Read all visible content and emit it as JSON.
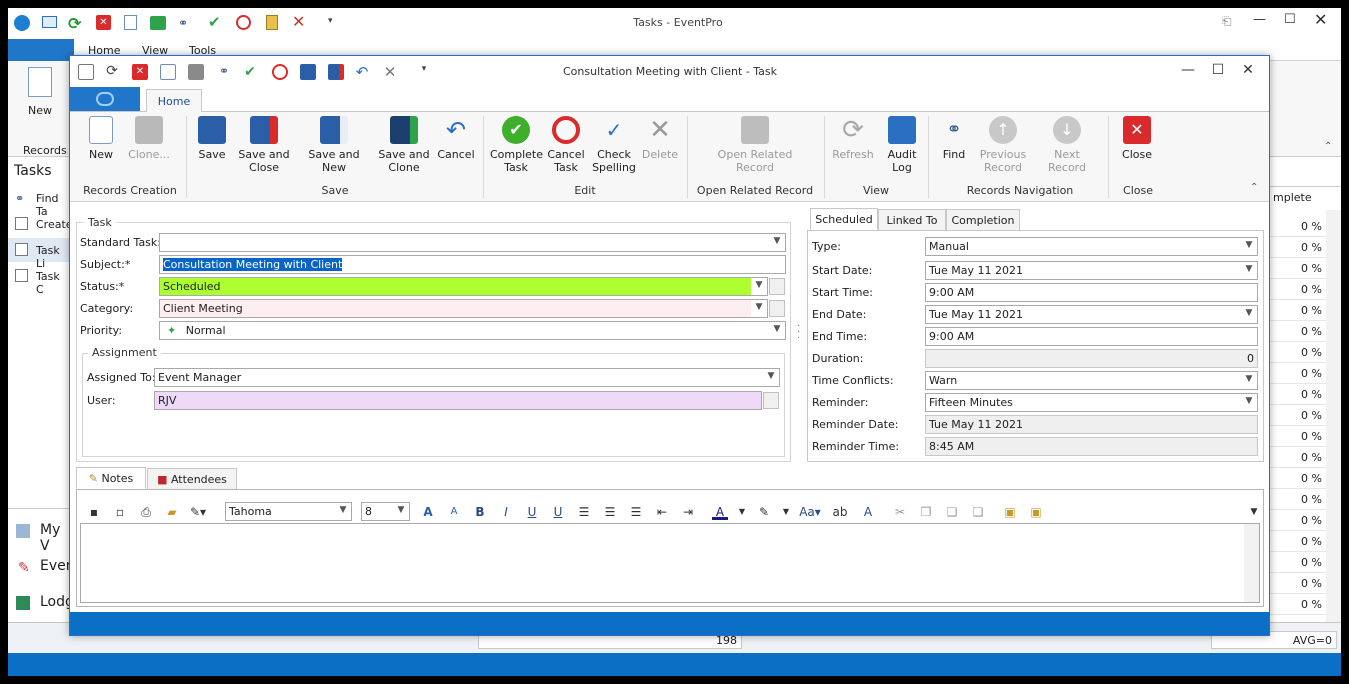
{
  "app": {
    "title": "Tasks - EventPro",
    "tabs": [
      "Home",
      "View",
      "Tools"
    ],
    "new_label": "New",
    "records_group": "Records C",
    "left_header": "Tasks",
    "left_items": [
      "Find Ta",
      "Create",
      "Task Li",
      "Task C"
    ],
    "nav_items": [
      "My V",
      "Even",
      "Lodg"
    ],
    "grid_header": "mplete",
    "grid_values": [
      "0 %",
      "0 %",
      "0 %",
      "0 %",
      "0 %",
      "0 %",
      "0 %",
      "0 %",
      "0 %",
      "0 %",
      "0 %",
      "0 %",
      "0 %",
      "0 %",
      "0 %",
      "0 %",
      "0 %",
      "0 %",
      "0 %"
    ],
    "status_count": "198",
    "status_avg": "AVG=0"
  },
  "dialog": {
    "title": "Consultation Meeting with Client - Task",
    "tab_home": "Home",
    "ribbon": {
      "new": "New",
      "clone": "Clone...",
      "save": "Save",
      "save_close": "Save and Close",
      "save_new": "Save and New",
      "save_clone": "Save and Clone",
      "cancel": "Cancel",
      "complete_task": "Complete Task",
      "cancel_task": "Cancel Task",
      "check_spelling": "Check Spelling",
      "delete": "Delete",
      "open_related": "Open Related Record",
      "refresh": "Refresh",
      "audit_log": "Audit Log",
      "find": "Find",
      "previous_record": "Previous Record",
      "next_record": "Next Record",
      "close": "Close",
      "groups": {
        "records_creation": "Records Creation",
        "save": "Save",
        "edit": "Edit",
        "open_related": "Open Related Record",
        "view": "View",
        "records_navigation": "Records Navigation",
        "close": "Close"
      }
    },
    "task": {
      "legend": "Task",
      "standard_task_label": "Standard Task:",
      "standard_task_value": "",
      "subject_label": "Subject:*",
      "subject_value": "Consultation Meeting with Client",
      "status_label": "Status:*",
      "status_value": "Scheduled",
      "category_label": "Category:",
      "category_value": "Client Meeting",
      "priority_label": "Priority:",
      "priority_value": "Normal",
      "assignment_legend": "Assignment",
      "assigned_to_label": "Assigned To:",
      "assigned_to_value": "Event Manager",
      "user_label": "User:",
      "user_value": "RJV"
    },
    "sched": {
      "tabs": [
        "Scheduled",
        "Linked To",
        "Completion"
      ],
      "type_label": "Type:",
      "type_value": "Manual",
      "start_date_label": "Start Date:",
      "start_date_value": "Tue May 11 2021",
      "start_time_label": "Start Time:",
      "start_time_value": "9:00 AM",
      "end_date_label": "End Date:",
      "end_date_value": "Tue May 11 2021",
      "end_time_label": "End Time:",
      "end_time_value": "9:00 AM",
      "duration_label": "Duration:",
      "duration_value": "0",
      "conflicts_label": "Time Conflicts:",
      "conflicts_value": "Warn",
      "reminder_label": "Reminder:",
      "reminder_value": "Fifteen Minutes",
      "reminder_date_label": "Reminder Date:",
      "reminder_date_value": "Tue May 11 2021",
      "reminder_time_label": "Reminder Time:",
      "reminder_time_value": "8:45 AM"
    },
    "notes": {
      "tab_notes": "Notes",
      "tab_attendees": "Attendees",
      "font_name": "Tahoma",
      "font_size": "8",
      "content": ""
    }
  },
  "colors": {
    "accent": "#0c6fc6",
    "status_green": "#adff2f",
    "category_pink": "#fdeef0",
    "user_violet": "#eed9f9",
    "selection": "#0a64c8"
  }
}
